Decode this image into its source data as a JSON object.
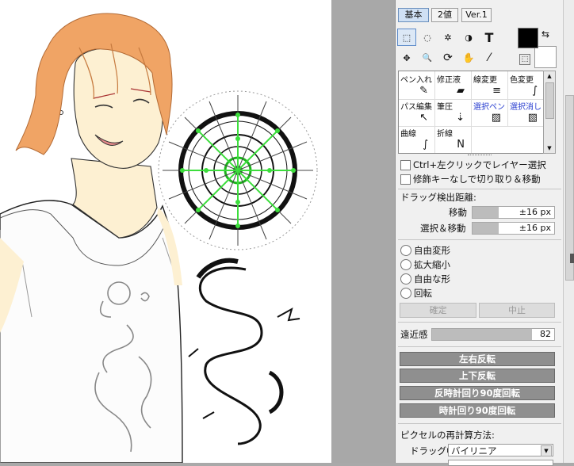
{
  "tabs": [
    "基本",
    "2値",
    "Ver.1"
  ],
  "tools": [
    {
      "name": "rect-select-icon",
      "glyph": "⬚"
    },
    {
      "name": "lasso-icon",
      "glyph": "◌"
    },
    {
      "name": "magic-wand-icon",
      "glyph": "✲"
    },
    {
      "name": "shape-icon",
      "glyph": "◑"
    },
    {
      "name": "text-tool-icon",
      "glyph": "T"
    },
    {
      "name": "move-icon",
      "glyph": "✥"
    },
    {
      "name": "zoom-icon",
      "glyph": "🔍"
    },
    {
      "name": "rotate-icon",
      "glyph": "⟳"
    },
    {
      "name": "hand-icon",
      "glyph": "✋"
    },
    {
      "name": "eyedropper-icon",
      "glyph": "⁄"
    }
  ],
  "colors": {
    "main": "#000000",
    "sub": "#ffffff",
    "accent": "#cfe0f4"
  },
  "brushes": [
    {
      "label": "ペン入れ",
      "icon": "pen-icon",
      "glyph": "✎",
      "blue": false
    },
    {
      "label": "修正液",
      "icon": "eraser-icon",
      "glyph": "▰",
      "blue": false
    },
    {
      "label": "線変更",
      "icon": "line-width-icon",
      "glyph": "≡",
      "blue": false
    },
    {
      "label": "色変更",
      "icon": "color-change-icon",
      "glyph": "∫",
      "blue": false
    },
    {
      "label": "パス編集",
      "icon": "path-edit-icon",
      "glyph": "↖",
      "blue": false
    },
    {
      "label": "筆圧",
      "icon": "pressure-icon",
      "glyph": "⇣",
      "blue": false
    },
    {
      "label": "選択ペン",
      "icon": "select-pen-icon",
      "glyph": "▨",
      "blue": true
    },
    {
      "label": "選択消し",
      "icon": "deselect-icon",
      "glyph": "▧",
      "blue": true
    },
    {
      "label": "曲線",
      "icon": "curve-icon",
      "glyph": "∫",
      "blue": false
    },
    {
      "label": "折線",
      "icon": "polyline-icon",
      "glyph": "N",
      "blue": false
    }
  ],
  "options": {
    "ctrl_select": "Ctrl+左クリックでレイヤー選択",
    "modifier_cut": "修飾キーなしで切り取り＆移動"
  },
  "drag": {
    "title": "ドラッグ検出距離:",
    "move_label": "移動",
    "move_value": "±16 px",
    "select_move_label": "選択＆移動",
    "select_move_value": "±16 px"
  },
  "transform": {
    "free": "自由変形",
    "scale": "拡大縮小",
    "free_shape": "自由な形",
    "rotate": "回転",
    "confirm": "確定",
    "cancel": "中止"
  },
  "perspective": {
    "label": "遠近感",
    "value": "82",
    "fraction": 0.82
  },
  "flip": {
    "horizontal": "左右反転",
    "vertical": "上下反転",
    "ccw": "反時計回り90度回転",
    "cw": "時計回り90度回転"
  },
  "resample": {
    "title": "ピクセルの再計算方法:",
    "dragging_label": "ドラッグ中",
    "dragging_value": "バイリニア"
  }
}
